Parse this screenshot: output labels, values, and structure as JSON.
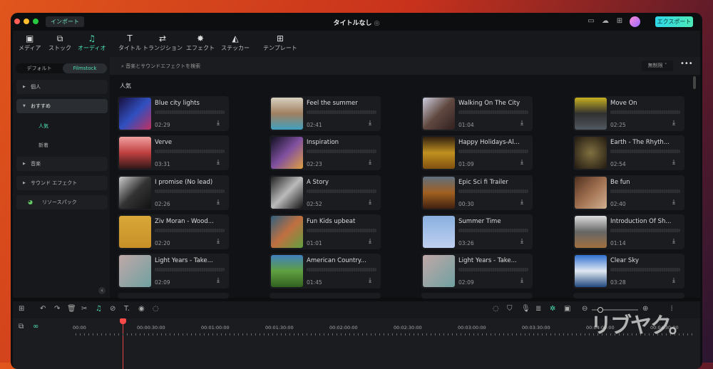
{
  "window": {
    "title": "タイトルなし",
    "import_label": "インポート",
    "export_label": "エクスポート"
  },
  "toolbar": {
    "items": [
      {
        "label": "メディア",
        "icon": "media-icon",
        "glyph": "▣"
      },
      {
        "label": "ストック",
        "icon": "stock-icon",
        "glyph": "⧉"
      },
      {
        "label": "オーディオ",
        "icon": "music-icon",
        "glyph": "♫",
        "active": true
      },
      {
        "label": "タイトル",
        "icon": "title-icon",
        "glyph": "T"
      },
      {
        "label": "トランジション",
        "icon": "transition-icon",
        "glyph": "⇄"
      },
      {
        "label": "エフェクト",
        "icon": "effect-icon",
        "glyph": "✸"
      },
      {
        "label": "ステッカー",
        "icon": "sticker-icon",
        "glyph": "◭"
      },
      {
        "label": "テンプレート",
        "icon": "template-icon",
        "glyph": "⊞"
      }
    ]
  },
  "sidebar": {
    "tabs": [
      "デフォルト",
      "Filmstock"
    ],
    "active_tab": "Filmstock",
    "categories": [
      "個人",
      "おすすめ",
      "音楽",
      "サウンド エフェクト",
      "リソースパック"
    ],
    "subitems": [
      "人気",
      "新着"
    ],
    "active_subitem": "人気"
  },
  "search": {
    "placeholder": "音楽とサウンドエフェクトを検索",
    "filter": "無制限",
    "more": "•••"
  },
  "section_title": "人気",
  "accent": "#4fe0b8",
  "tracks": [
    {
      "title": "Blue city lights",
      "duration": "02:29"
    },
    {
      "title": "Feel the summer",
      "duration": "02:41"
    },
    {
      "title": "Walking On The City",
      "duration": "01:04"
    },
    {
      "title": "Move On",
      "duration": "02:25"
    },
    {
      "title": "Verve",
      "duration": "03:31"
    },
    {
      "title": "Inspiration",
      "duration": "02:23"
    },
    {
      "title": "Happy Holidays-Al...",
      "duration": "01:09"
    },
    {
      "title": "Earth - The Rhyth...",
      "duration": "02:54"
    },
    {
      "title": "I promise (No lead)",
      "duration": "02:26"
    },
    {
      "title": "A Story",
      "duration": "02:52"
    },
    {
      "title": "Epic Sci fi Trailer",
      "duration": "00:30"
    },
    {
      "title": "Be fun",
      "duration": "02:40"
    },
    {
      "title": "Ziv Moran - Wood...",
      "duration": "02:20"
    },
    {
      "title": "Fun Kids upbeat",
      "duration": "01:01"
    },
    {
      "title": "Summer Time",
      "duration": "03:26"
    },
    {
      "title": "Introduction Of Sh...",
      "duration": "01:14"
    },
    {
      "title": "Light Years - Take...",
      "duration": "02:09"
    },
    {
      "title": "American Country...",
      "duration": "01:45"
    },
    {
      "title": "Light Years - Take...",
      "duration": "02:09"
    },
    {
      "title": "Clear Sky",
      "duration": "03:28"
    }
  ],
  "timeline": {
    "marks": [
      "00:00",
      "00:00:30:00",
      "00:01:00:00",
      "00:01:30:00",
      "00:02:00:00",
      "00:02:30:00",
      "00:03:00:00",
      "00:03:30:00",
      "00:04:00:00",
      "00:04:30:00"
    ]
  },
  "watermark": "リブヤク。"
}
